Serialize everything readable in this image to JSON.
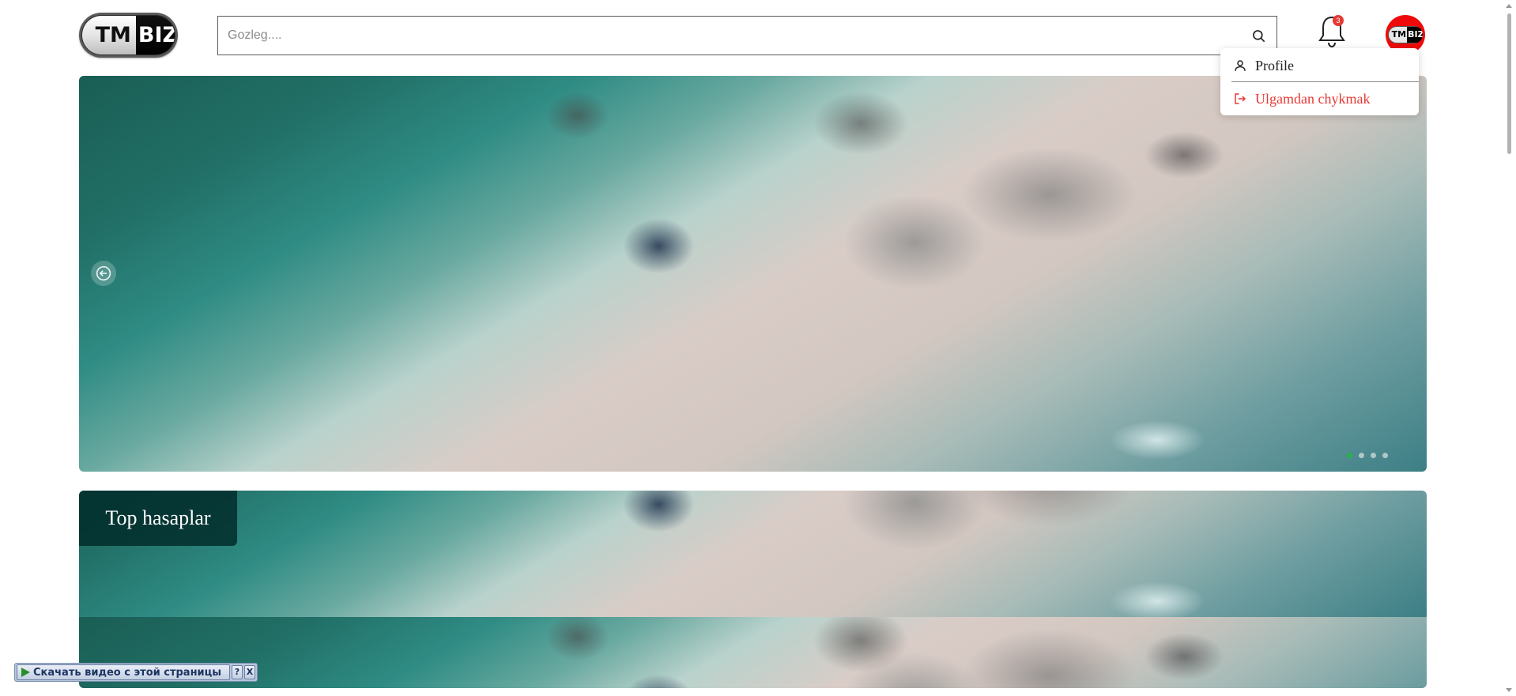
{
  "header": {
    "logo": {
      "left": "TM",
      "right": "BIZ"
    },
    "search": {
      "placeholder": "Gozleg...."
    },
    "notifications": {
      "count": "3"
    },
    "avatar": {
      "left": "TM",
      "right": "BIZ"
    }
  },
  "user_menu": {
    "items": [
      {
        "label": "Profile",
        "icon": "user-icon"
      },
      {
        "label": "Ulgamdan chykmak",
        "icon": "logout-icon",
        "color": "#e53935"
      }
    ]
  },
  "hero_carousel": {
    "slide_count": 4,
    "active_index": 0,
    "active_dot_color": "#27b34a"
  },
  "top_section": {
    "title": "Top hasaplar"
  },
  "download_widget": {
    "label": "Скачать видео с этой страницы",
    "help": "?",
    "close": "X"
  },
  "colors": {
    "accent_red": "#ee0a0a",
    "danger_text": "#e53935"
  }
}
